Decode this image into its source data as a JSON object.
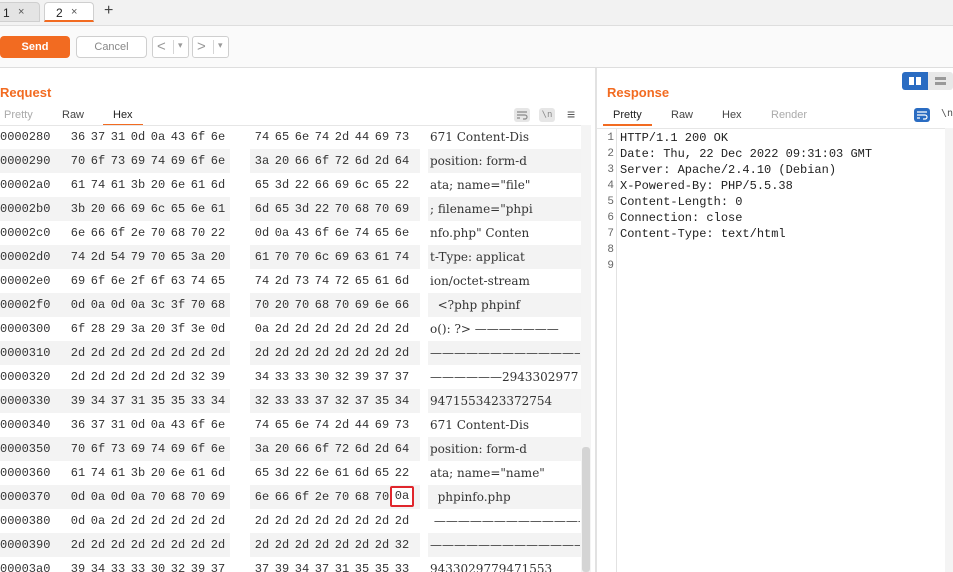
{
  "tabs": [
    {
      "label": "1",
      "close": "×"
    },
    {
      "label": "2",
      "close": "×"
    }
  ],
  "new_tab": "+",
  "toolbar": {
    "send_label": "Send",
    "cancel_label": "Cancel",
    "back_arrow": "<",
    "forward_arrow": ">",
    "dropdown": "▾"
  },
  "request": {
    "title": "Request",
    "subtabs": [
      "Pretty",
      "Raw",
      "Hex"
    ],
    "active_subtab": "Hex",
    "icons": [
      "word-wrap-icon",
      "newline-icon",
      "menu-icon"
    ],
    "newline_glyph": "\\n",
    "menu_glyph": "≡",
    "rows": [
      {
        "offset": "0000280",
        "bytes": [
          "36",
          "37",
          "31",
          "0d",
          "0a",
          "43",
          "6f",
          "6e",
          "74",
          "65",
          "6e",
          "74",
          "2d",
          "44",
          "69",
          "73"
        ],
        "ascii": "671 Content-Dis"
      },
      {
        "offset": "0000290",
        "bytes": [
          "70",
          "6f",
          "73",
          "69",
          "74",
          "69",
          "6f",
          "6e",
          "3a",
          "20",
          "66",
          "6f",
          "72",
          "6d",
          "2d",
          "64"
        ],
        "ascii": "position: form-d"
      },
      {
        "offset": "00002a0",
        "bytes": [
          "61",
          "74",
          "61",
          "3b",
          "20",
          "6e",
          "61",
          "6d",
          "65",
          "3d",
          "22",
          "66",
          "69",
          "6c",
          "65",
          "22"
        ],
        "ascii": "ata; name=\"file\""
      },
      {
        "offset": "00002b0",
        "bytes": [
          "3b",
          "20",
          "66",
          "69",
          "6c",
          "65",
          "6e",
          "61",
          "6d",
          "65",
          "3d",
          "22",
          "70",
          "68",
          "70",
          "69"
        ],
        "ascii": "; filename=\"phpi"
      },
      {
        "offset": "00002c0",
        "bytes": [
          "6e",
          "66",
          "6f",
          "2e",
          "70",
          "68",
          "70",
          "22",
          "0d",
          "0a",
          "43",
          "6f",
          "6e",
          "74",
          "65",
          "6e"
        ],
        "ascii": "nfo.php\" Conten"
      },
      {
        "offset": "00002d0",
        "bytes": [
          "74",
          "2d",
          "54",
          "79",
          "70",
          "65",
          "3a",
          "20",
          "61",
          "70",
          "70",
          "6c",
          "69",
          "63",
          "61",
          "74"
        ],
        "ascii": "t-Type: applicat"
      },
      {
        "offset": "00002e0",
        "bytes": [
          "69",
          "6f",
          "6e",
          "2f",
          "6f",
          "63",
          "74",
          "65",
          "74",
          "2d",
          "73",
          "74",
          "72",
          "65",
          "61",
          "6d"
        ],
        "ascii": "ion/octet-stream"
      },
      {
        "offset": "00002f0",
        "bytes": [
          "0d",
          "0a",
          "0d",
          "0a",
          "3c",
          "3f",
          "70",
          "68",
          "70",
          "20",
          "70",
          "68",
          "70",
          "69",
          "6e",
          "66"
        ],
        "ascii": "  <?php phpinf"
      },
      {
        "offset": "0000300",
        "bytes": [
          "6f",
          "28",
          "29",
          "3a",
          "20",
          "3f",
          "3e",
          "0d",
          "0a",
          "2d",
          "2d",
          "2d",
          "2d",
          "2d",
          "2d",
          "2d"
        ],
        "ascii": "o(): ?> ———————"
      },
      {
        "offset": "0000310",
        "bytes": [
          "2d",
          "2d",
          "2d",
          "2d",
          "2d",
          "2d",
          "2d",
          "2d",
          "2d",
          "2d",
          "2d",
          "2d",
          "2d",
          "2d",
          "2d",
          "2d"
        ],
        "ascii": "————————————————"
      },
      {
        "offset": "0000320",
        "bytes": [
          "2d",
          "2d",
          "2d",
          "2d",
          "2d",
          "2d",
          "32",
          "39",
          "34",
          "33",
          "33",
          "30",
          "32",
          "39",
          "37",
          "37"
        ],
        "ascii": "——————2943302977"
      },
      {
        "offset": "0000330",
        "bytes": [
          "39",
          "34",
          "37",
          "31",
          "35",
          "35",
          "33",
          "34",
          "32",
          "33",
          "33",
          "37",
          "32",
          "37",
          "35",
          "34"
        ],
        "ascii": "9471553423372754"
      },
      {
        "offset": "0000340",
        "bytes": [
          "36",
          "37",
          "31",
          "0d",
          "0a",
          "43",
          "6f",
          "6e",
          "74",
          "65",
          "6e",
          "74",
          "2d",
          "44",
          "69",
          "73"
        ],
        "ascii": "671 Content-Dis"
      },
      {
        "offset": "0000350",
        "bytes": [
          "70",
          "6f",
          "73",
          "69",
          "74",
          "69",
          "6f",
          "6e",
          "3a",
          "20",
          "66",
          "6f",
          "72",
          "6d",
          "2d",
          "64"
        ],
        "ascii": "position: form-d"
      },
      {
        "offset": "0000360",
        "bytes": [
          "61",
          "74",
          "61",
          "3b",
          "20",
          "6e",
          "61",
          "6d",
          "65",
          "3d",
          "22",
          "6e",
          "61",
          "6d",
          "65",
          "22"
        ],
        "ascii": "ata; name=\"name\""
      },
      {
        "offset": "0000370",
        "bytes": [
          "0d",
          "0a",
          "0d",
          "0a",
          "70",
          "68",
          "70",
          "69",
          "6e",
          "66",
          "6f",
          "2e",
          "70",
          "68",
          "70",
          "0a"
        ],
        "ascii": "  phpinfo.php"
      },
      {
        "offset": "0000380",
        "bytes": [
          "0d",
          "0a",
          "2d",
          "2d",
          "2d",
          "2d",
          "2d",
          "2d",
          "2d",
          "2d",
          "2d",
          "2d",
          "2d",
          "2d",
          "2d",
          "2d"
        ],
        "ascii": " ——————————————"
      },
      {
        "offset": "0000390",
        "bytes": [
          "2d",
          "2d",
          "2d",
          "2d",
          "2d",
          "2d",
          "2d",
          "2d",
          "2d",
          "2d",
          "2d",
          "2d",
          "2d",
          "2d",
          "2d",
          "32"
        ],
        "ascii": "———————————————2"
      },
      {
        "offset": "00003a0",
        "bytes": [
          "39",
          "34",
          "33",
          "33",
          "30",
          "32",
          "39",
          "37",
          "37",
          "39",
          "34",
          "37",
          "31",
          "35",
          "35",
          "33"
        ],
        "ascii": "9433029779471553"
      }
    ],
    "selected": {
      "row": 15,
      "byte": 15
    }
  },
  "response": {
    "title": "Response",
    "subtabs": [
      "Pretty",
      "Raw",
      "Hex",
      "Render"
    ],
    "active_subtab": "Pretty",
    "newline_glyph": "\\n",
    "lines": [
      "HTTP/1.1 200 OK",
      "Date: Thu, 22 Dec 2022 09:31:03 GMT",
      "Server: Apache/2.4.10 (Debian)",
      "X-Powered-By: PHP/5.5.38",
      "Content-Length: 0",
      "Connection: close",
      "Content-Type: text/html",
      "",
      ""
    ]
  },
  "colors": {
    "accent": "#f26b21",
    "selection_border": "#e0262c",
    "toggle_active": "#2a6cc2"
  }
}
